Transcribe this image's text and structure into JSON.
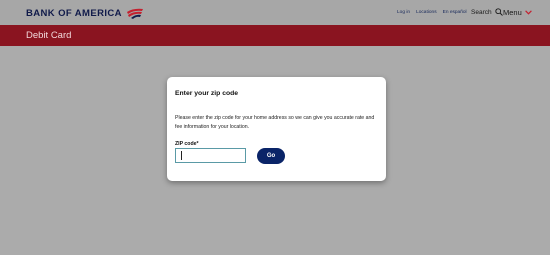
{
  "header": {
    "logo_text": "BANK OF AMERICA",
    "links": [
      "Log in",
      "Locations",
      "En español"
    ],
    "search_label": "Search",
    "menu_label": "Menu"
  },
  "banner": {
    "title": "Debit Card"
  },
  "modal": {
    "title": "Enter your zip code",
    "description": "Please enter the zip code for your home address so we can give you accurate rate and fee information for your location.",
    "zip_label": "ZIP code*",
    "zip_value": "",
    "go_label": "Go"
  },
  "colors": {
    "brand_navy": "#0a2468",
    "brand_red": "#8a1420",
    "overlay_gray": "#ababab"
  },
  "icons": [
    "flag-logo-icon",
    "search-icon",
    "chevron-down-icon"
  ]
}
